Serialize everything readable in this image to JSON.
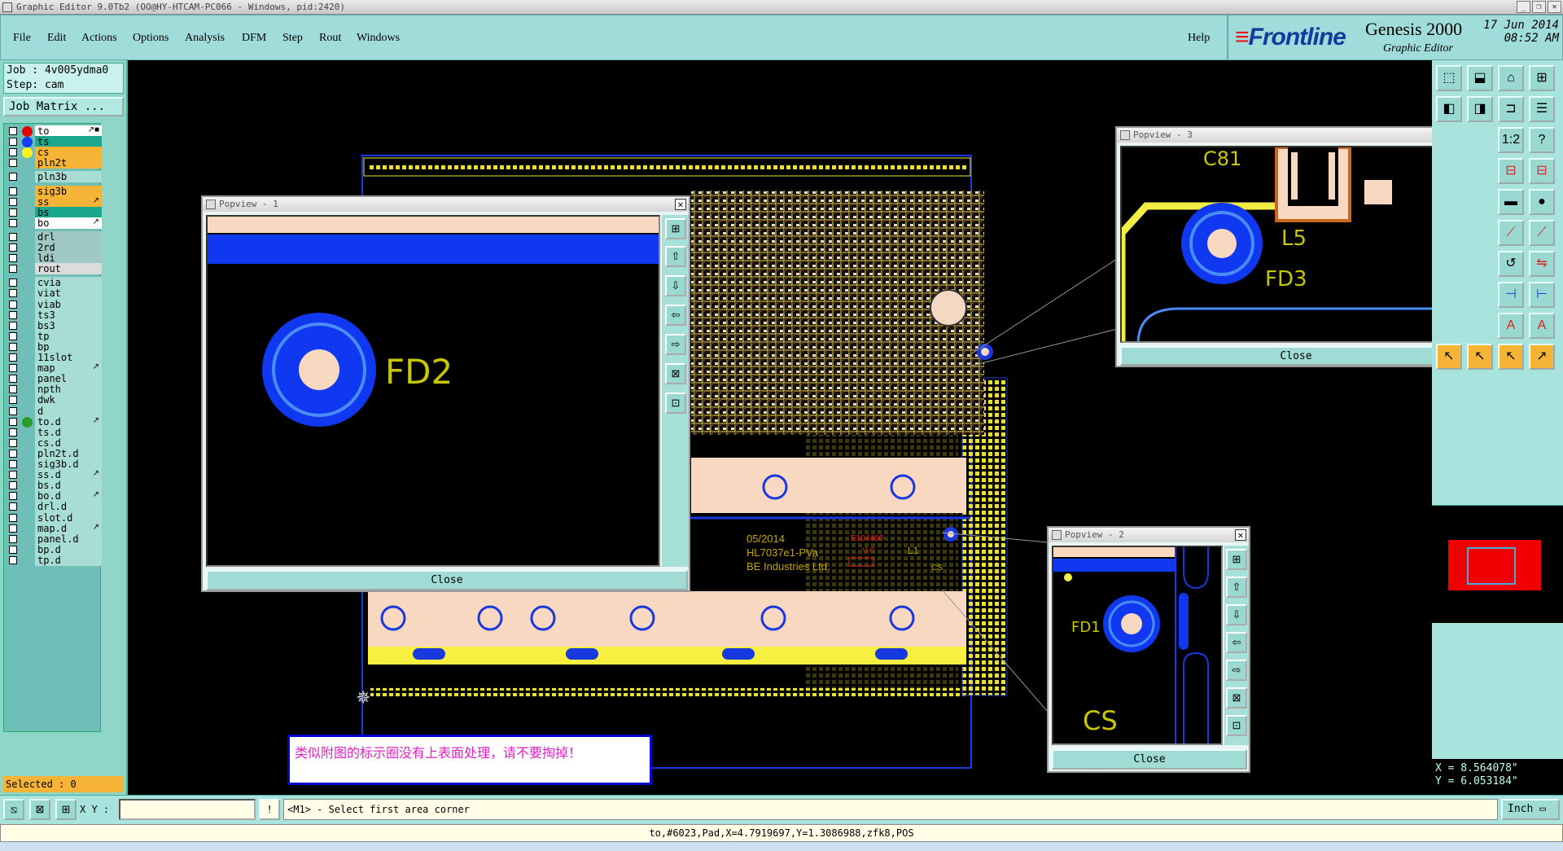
{
  "window": {
    "title": "Graphic Editor 9.0Tb2 (OO@HY-HTCAM-PC066 - Windows, pid:2420)"
  },
  "menu": {
    "items": [
      "File",
      "Edit",
      "Actions",
      "Options",
      "Analysis",
      "DFM",
      "Step",
      "Rout",
      "Windows"
    ],
    "help": "Help"
  },
  "brand": {
    "logo": "Frontline",
    "product": "Genesis 2000",
    "subtitle": "Graphic Editor",
    "date": "17 Jun 2014",
    "time": "08:52 AM"
  },
  "job": {
    "job_label": "Job : 4v005ydma0",
    "step_label": "Step: cam",
    "job_matrix": "Job Matrix ..."
  },
  "layers": [
    {
      "name": "to",
      "bg": "#ffffff",
      "dot": "#e00000",
      "edit": "↗■"
    },
    {
      "name": "ts",
      "bg": "#1aa88c",
      "dot": "#1040ff",
      "edit": ""
    },
    {
      "name": "cs",
      "bg": "#f6b436",
      "dot": "#ffee22",
      "edit": ""
    },
    {
      "name": "pln2t",
      "bg": "#f6b436",
      "dot": "",
      "edit": ""
    },
    {
      "name": "pln3b",
      "bg": "#a8ddd6",
      "dot": "",
      "edit": ""
    },
    {
      "name": "sig3b",
      "bg": "#f6b436",
      "dot": "",
      "edit": ""
    },
    {
      "name": "ss",
      "bg": "#f6b436",
      "dot": "",
      "edit": "↗"
    },
    {
      "name": "bs",
      "bg": "#1aa88c",
      "dot": "",
      "edit": ""
    },
    {
      "name": "bo",
      "bg": "#ffffff",
      "dot": "",
      "edit": "↗"
    },
    {
      "name": "drl",
      "bg": "#a0c8c4",
      "dot": "",
      "edit": ""
    },
    {
      "name": "2rd",
      "bg": "#a0c8c4",
      "dot": "",
      "edit": ""
    },
    {
      "name": "ldi",
      "bg": "#a0c8c4",
      "dot": "",
      "edit": ""
    },
    {
      "name": "rout",
      "bg": "#dcdcdc",
      "dot": "",
      "edit": ""
    },
    {
      "name": "cvia",
      "bg": "#a8ddd6",
      "dot": "",
      "edit": ""
    },
    {
      "name": "viat",
      "bg": "#a8ddd6",
      "dot": "",
      "edit": ""
    },
    {
      "name": "viab",
      "bg": "#a8ddd6",
      "dot": "",
      "edit": ""
    },
    {
      "name": "ts3",
      "bg": "#a8ddd6",
      "dot": "",
      "edit": ""
    },
    {
      "name": "bs3",
      "bg": "#a8ddd6",
      "dot": "",
      "edit": ""
    },
    {
      "name": "tp",
      "bg": "#a8ddd6",
      "dot": "",
      "edit": ""
    },
    {
      "name": "bp",
      "bg": "#a8ddd6",
      "dot": "",
      "edit": ""
    },
    {
      "name": "11slot",
      "bg": "#a8ddd6",
      "dot": "",
      "edit": ""
    },
    {
      "name": "map",
      "bg": "#a8ddd6",
      "dot": "",
      "edit": "↗"
    },
    {
      "name": "panel",
      "bg": "#a8ddd6",
      "dot": "",
      "edit": ""
    },
    {
      "name": "npth",
      "bg": "#a8ddd6",
      "dot": "",
      "edit": ""
    },
    {
      "name": "dwk",
      "bg": "#a8ddd6",
      "dot": "",
      "edit": ""
    },
    {
      "name": "d",
      "bg": "#a8ddd6",
      "dot": "",
      "edit": ""
    },
    {
      "name": "to.d",
      "bg": "#a8ddd6",
      "dot": "#2a9a2a",
      "edit": "↗"
    },
    {
      "name": "ts.d",
      "bg": "#a8ddd6",
      "dot": "",
      "edit": ""
    },
    {
      "name": "cs.d",
      "bg": "#a8ddd6",
      "dot": "",
      "edit": ""
    },
    {
      "name": "pln2t.d",
      "bg": "#a8ddd6",
      "dot": "",
      "edit": ""
    },
    {
      "name": "sig3b.d",
      "bg": "#a8ddd6",
      "dot": "",
      "edit": ""
    },
    {
      "name": "ss.d",
      "bg": "#a8ddd6",
      "dot": "",
      "edit": "↗"
    },
    {
      "name": "bs.d",
      "bg": "#a8ddd6",
      "dot": "",
      "edit": ""
    },
    {
      "name": "bo.d",
      "bg": "#a8ddd6",
      "dot": "",
      "edit": "↗"
    },
    {
      "name": "drl.d",
      "bg": "#a8ddd6",
      "dot": "",
      "edit": ""
    },
    {
      "name": "slot.d",
      "bg": "#a8ddd6",
      "dot": "",
      "edit": ""
    },
    {
      "name": "map.d",
      "bg": "#a8ddd6",
      "dot": "",
      "edit": "↗"
    },
    {
      "name": "panel.d",
      "bg": "#a8ddd6",
      "dot": "",
      "edit": ""
    },
    {
      "name": "bp.d",
      "bg": "#a8ddd6",
      "dot": "",
      "edit": ""
    },
    {
      "name": "tp.d",
      "bg": "#a8ddd6",
      "dot": "",
      "edit": ""
    }
  ],
  "selected": "Selected : 0",
  "board": {
    "date_code": "05/2014",
    "part_no": "HL7037e1-PVa",
    "company": "BE Industries Ltd.",
    "ul_mark": "E104460",
    "ul_rating": "V-0",
    "l1": "L1",
    "fd_small": "FD2",
    "cs_small": "CS",
    "fd3_small": "FD3"
  },
  "popups": [
    {
      "title": "Popview - 1",
      "label": "FD2",
      "close": "Close"
    },
    {
      "title": "Popview - 2",
      "label": "FD1",
      "label2": "CS",
      "close": "Close"
    },
    {
      "title": "Popview - 3",
      "label": "C81",
      "label2": "L5",
      "label3": "FD3",
      "close": "Close"
    }
  ],
  "note": "类似附图的标示圈没有上表面处理，请不要掏掉！",
  "coords": {
    "x": "X = 8.564078\"",
    "y": "Y = 6.053184\""
  },
  "bottom": {
    "xy_label": "X Y :",
    "xy_value": "",
    "prompt": "<M1> - Select first area corner",
    "units": "Inch"
  },
  "status": "to,#6023,Pad,X=4.7919697,Y=1.3086988,zfk8,POS",
  "colors": {
    "pad_blue": "#1038f0",
    "pad_peach": "#f8d8c0",
    "silk_yellow": "#c8c800",
    "trace_yellow": "#f2ee44",
    "menu_bg": "#a0dcd9"
  }
}
